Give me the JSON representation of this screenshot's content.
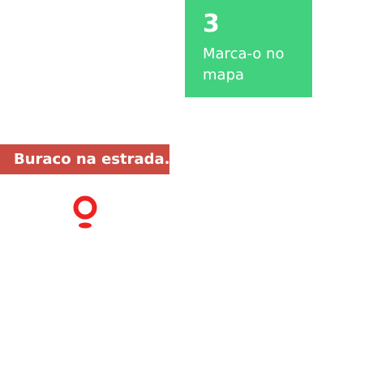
{
  "step": {
    "number": "3",
    "text": "Marca-o no mapa"
  },
  "report": {
    "label": "Buraco na estrada."
  },
  "pin": {
    "icon": "map-pin-icon",
    "color": "#ee2222"
  },
  "colors": {
    "step_card": "#42d17f",
    "report_label": "#cb4b43"
  }
}
